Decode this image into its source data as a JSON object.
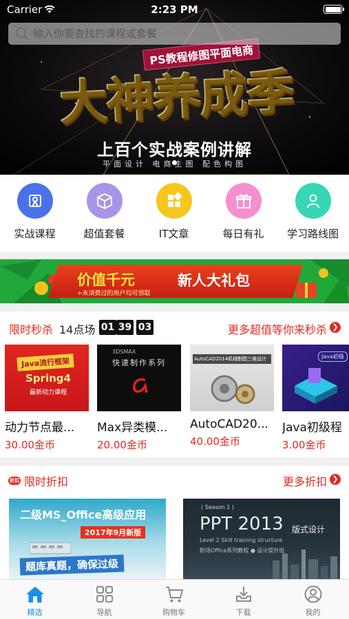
{
  "status_bar": {
    "carrier": "Carrier",
    "time": "2:23 PM"
  },
  "search": {
    "placeholder": "输入你要查找的课程或套餐"
  },
  "hero": {
    "tag": "PS教程修图平面电商",
    "title": "大神养成季",
    "subtitle": "上百个实战案例讲解",
    "caption": "平面设计  电商主图  配色构图"
  },
  "categories": [
    {
      "label": "实战课程",
      "icon": "puzzle-icon",
      "color": "#4a72e8"
    },
    {
      "label": "超值套餐",
      "icon": "box-icon",
      "color": "#a995e8"
    },
    {
      "label": "IT文章",
      "icon": "blocks-icon",
      "color": "#f7c51c"
    },
    {
      "label": "每日有礼",
      "icon": "gift-icon",
      "color": "#f58fcf"
    },
    {
      "label": "学习路线图",
      "icon": "person-icon",
      "color": "#37d6b6"
    }
  ],
  "promo_banner": {
    "value_text": "价值千元",
    "note": "+未消费过的用户均可领取",
    "gift_text": "新人大礼包"
  },
  "flash_sale": {
    "title": "限时秒杀",
    "session": "14点场",
    "countdown": {
      "h": "01",
      "m": "39",
      "s": "03"
    },
    "more": "更多超值等你来秒杀",
    "courses": [
      {
        "title": "动力节点最...",
        "price": "30.00金币",
        "thumb_text_1": "Java流行框架",
        "thumb_text_2": "Spring4",
        "thumb_text_3": "最新动力课程"
      },
      {
        "title": "Max异类模...",
        "price": "20.00金币",
        "thumb_text_1": "3DSMAX",
        "thumb_text_2": "快速制作系列"
      },
      {
        "title": "AutoCAD20...",
        "price": "40.00金币",
        "thumb_text_1": "AutoCAD2014机械制图三维设计"
      },
      {
        "title": "Java初级程",
        "price": "3.00金币",
        "thumb_text_1": "Java初级"
      }
    ]
  },
  "discount": {
    "badge": "折扣",
    "title": "限时折扣",
    "more": "更多折扣",
    "cards": [
      {
        "line1": "二级MS_Office高级应用",
        "line2": "2017年9月新版",
        "line3": "题库真题，确保过级"
      },
      {
        "line1": "( Season 1 )",
        "line2": "PPT 2013",
        "line3": "版式设计",
        "line4": "Level 2 Skill training structure",
        "line5": "职场Office系列教程 ● 设计提升班"
      }
    ]
  },
  "tabbar": {
    "active_color": "#1b8fe8",
    "tabs": [
      {
        "label": "精选",
        "icon": "home-icon"
      },
      {
        "label": "导航",
        "icon": "grid-icon"
      },
      {
        "label": "购物车",
        "icon": "cart-icon"
      },
      {
        "label": "下载",
        "icon": "download-icon"
      },
      {
        "label": "我的",
        "icon": "user-icon"
      }
    ]
  }
}
